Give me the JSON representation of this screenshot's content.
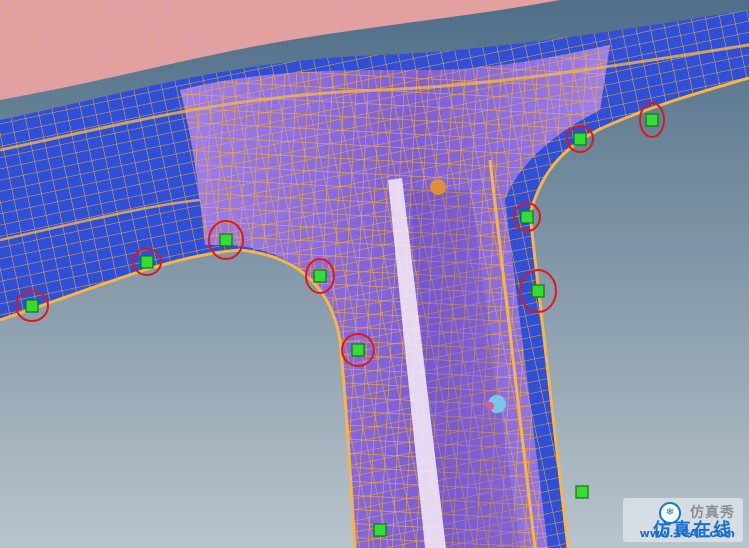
{
  "viewport": {
    "background_top": "#4f6e88",
    "background_bottom": "#b9c4cb",
    "mesh_line_color": "#f2ad38",
    "mesh_face_light": "#9f7fe8",
    "mesh_face_dark": "#7d5fd6",
    "side_face_color": "#2f4fd6",
    "top_panel_color": "#e0a0a4",
    "rib_color": "#f1e6f6",
    "node_color": "#33dd33",
    "node_edge_color": "#0c7a12",
    "highlight_circle_color": "#e01818",
    "markers": [
      {
        "name": "weld-node-01"
      },
      {
        "name": "weld-node-02"
      },
      {
        "name": "weld-node-03"
      },
      {
        "name": "weld-node-04"
      },
      {
        "name": "weld-node-05"
      },
      {
        "name": "weld-node-06"
      },
      {
        "name": "weld-node-07"
      },
      {
        "name": "weld-node-08"
      },
      {
        "name": "weld-node-09"
      }
    ],
    "unmarked_nodes": [
      {
        "name": "node-lower-1"
      },
      {
        "name": "node-lower-2"
      }
    ],
    "orange_node_color": "#e08e3a",
    "cyan_node_color": "#7cc5ea"
  },
  "watermark": {
    "badge": "❄",
    "name": "仿真秀",
    "title": "仿真在线",
    "site": "www.1CAE.com"
  }
}
